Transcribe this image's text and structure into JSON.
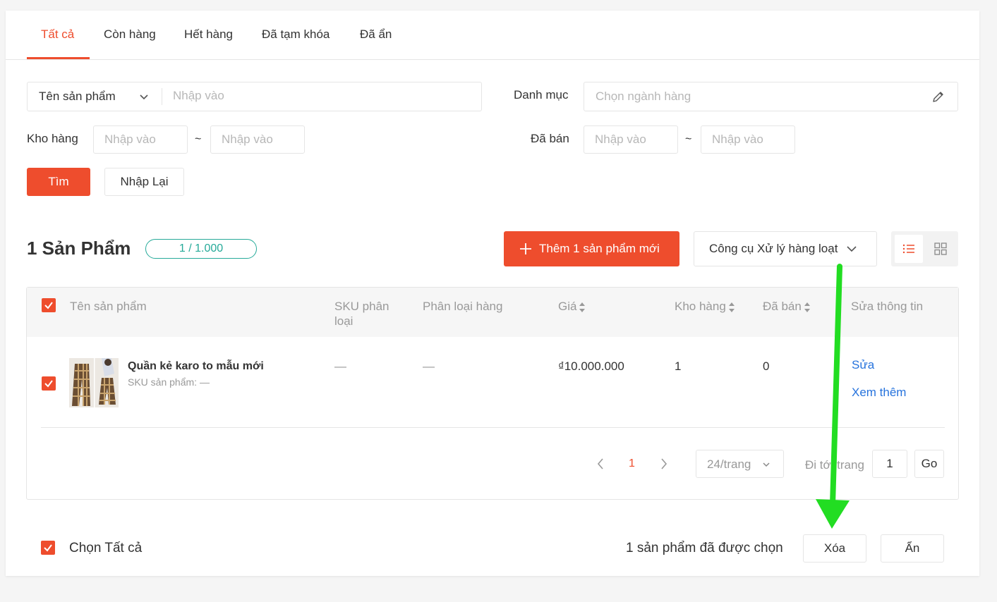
{
  "tabs": [
    "Tất cả",
    "Còn hàng",
    "Hết hàng",
    "Đã tạm khóa",
    "Đã ẩn"
  ],
  "filters": {
    "name_select": "Tên sản phẩm",
    "name_placeholder": "Nhập vào",
    "category_label": "Danh mục",
    "category_placeholder": "Chọn ngành hàng",
    "stock_label": "Kho hàng",
    "sold_label": "Đã bán",
    "range_placeholder": "Nhập vào",
    "tilde": "~",
    "search_button": "Tìm",
    "reset_button": "Nhập Lại"
  },
  "summary": {
    "count_title": "1 Sản Phẩm",
    "quota": "1 / 1.000",
    "add_button": "Thêm 1 sản phẩm mới",
    "bulk_tool": "Công cụ Xử lý hàng loạt"
  },
  "table": {
    "headers": {
      "name": "Tên sản phẩm",
      "sku": "SKU phân loại",
      "variation": "Phân loại hàng",
      "price": "Giá",
      "stock": "Kho hàng",
      "sold": "Đã bán",
      "edit": "Sửa thông tin"
    },
    "rows": [
      {
        "name": "Quần kẻ karo to mẫu mới",
        "sku_line": "SKU sản phẩm: —",
        "sku": "—",
        "variation": "—",
        "price": "₫10.000.000",
        "stock": "1",
        "sold": "0",
        "edit": "Sửa",
        "more": "Xem thêm"
      }
    ]
  },
  "pagination": {
    "current": "1",
    "per_page": "24/trang",
    "goto_label": "Đi tới trang",
    "goto_value": "1",
    "go_button": "Go"
  },
  "footer": {
    "select_all": "Chọn Tất cả",
    "selected_text": "1 sản phẩm đã được chọn",
    "delete_button": "Xóa",
    "hide_button": "Ẩn"
  },
  "colors": {
    "accent": "#ee4d2d",
    "quota": "#26aa99",
    "link": "#2673dd",
    "arrow": "#22dd22"
  }
}
